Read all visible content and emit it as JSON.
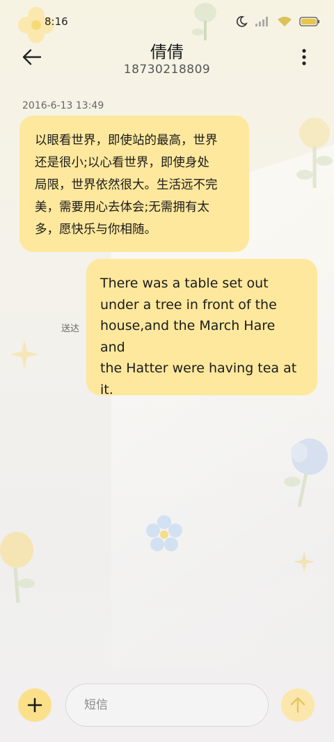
{
  "status_bar": {
    "time": "8:16",
    "icons": [
      "moon-icon",
      "signal-icon",
      "wifi-icon",
      "battery-icon"
    ]
  },
  "header": {
    "back_icon": "arrow-left-icon",
    "contact_name": "倩倩",
    "contact_number": "18730218809",
    "more_icon": "more-vertical-icon"
  },
  "conversation": {
    "timestamp": "2016-6-13 13:49",
    "messages": [
      {
        "direction": "incoming",
        "lines": [
          "以眼看世界，即使站的最高，世界",
          "还是很小;以心看世界，即使身处",
          "局限，世界依然很大。生活远不完",
          "美，需要用心去体会;无需拥有太",
          "多，愿快乐与你相随。"
        ]
      },
      {
        "direction": "outgoing",
        "lines": [
          "There was a table set out",
          "under a tree in front of the",
          "house,and the March Hare and",
          "the Hatter were having tea at",
          "it."
        ],
        "status": "送达"
      }
    ]
  },
  "composer": {
    "add_icon": "plus-icon",
    "placeholder": "短信",
    "value": "",
    "send_icon": "arrow-up-icon"
  },
  "colors": {
    "bubble": "#fde89d",
    "add_button": "#fbe08a",
    "send_button": "#fbe7ab"
  }
}
